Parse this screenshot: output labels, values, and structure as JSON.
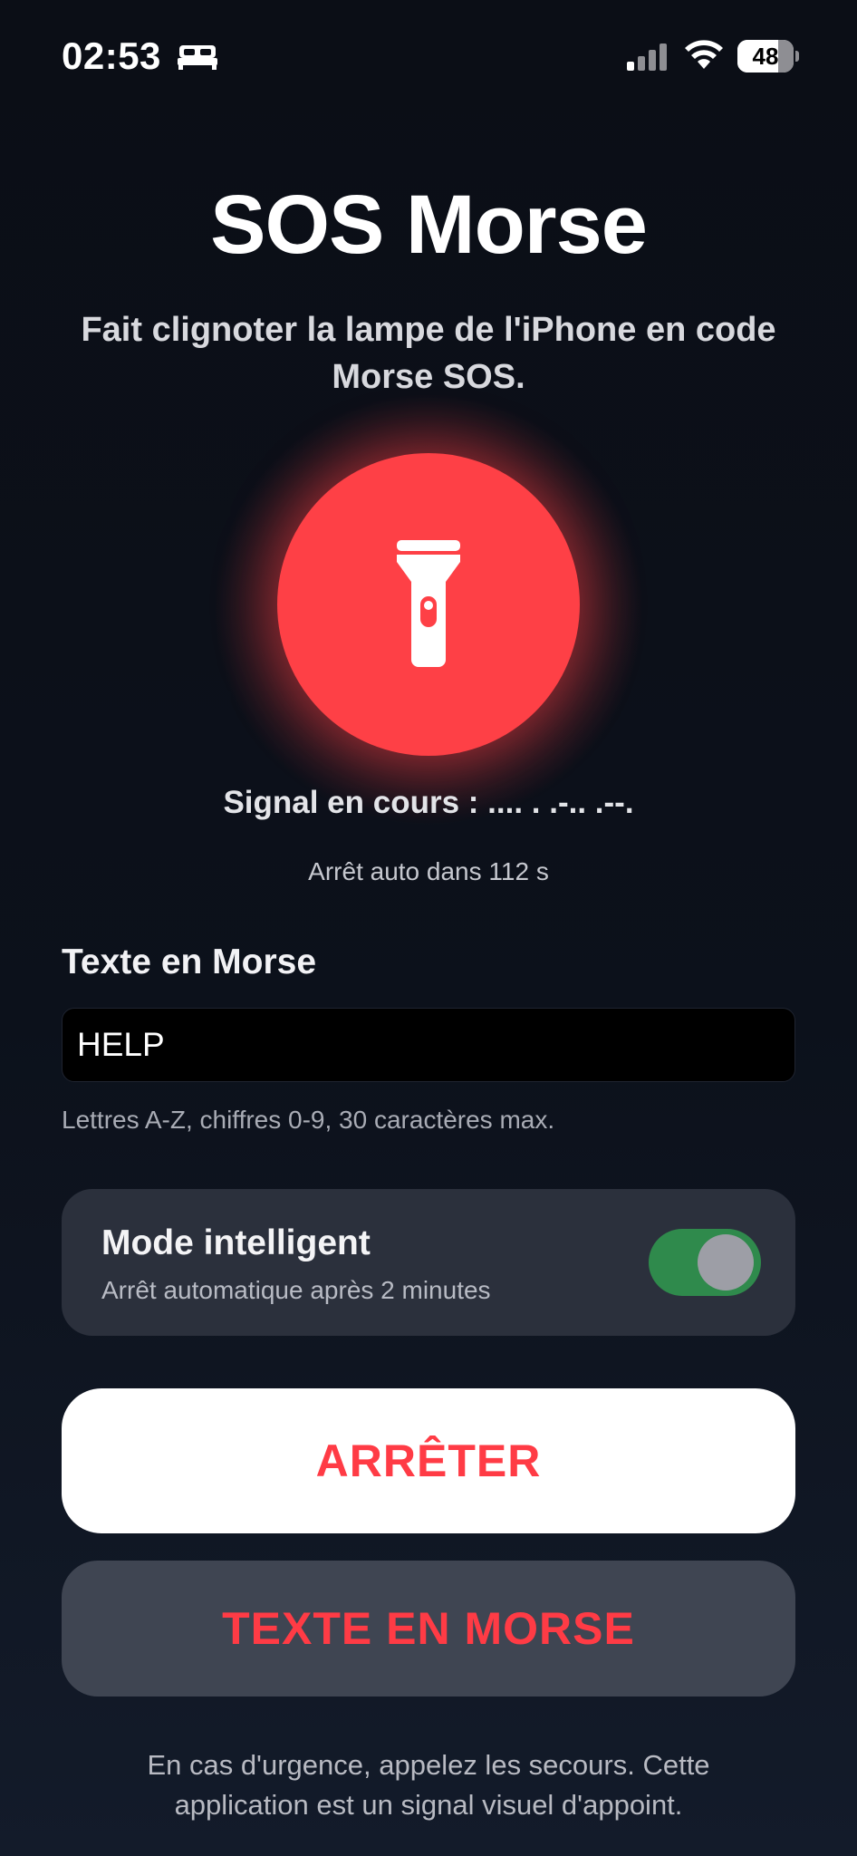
{
  "status_bar": {
    "time": "02:53",
    "battery_percent": "48",
    "battery_level": 0.48,
    "icons": [
      "bed-icon",
      "cellular-signal-icon",
      "wifi-icon",
      "battery-icon"
    ]
  },
  "header": {
    "title": "SOS Morse",
    "subtitle": "Fait clignoter la lampe de l'iPhone en code Morse SOS."
  },
  "flash": {
    "icon": "flashlight-icon",
    "color": "#fe4046"
  },
  "signal": {
    "status": "Signal en cours : .... . .-.. .--.",
    "auto_stop": "Arrêt auto dans 112 s"
  },
  "text_section": {
    "label": "Texte en Morse",
    "value": "HELP",
    "hint": "Lettres A-Z, chiffres 0-9, 30 caractères max."
  },
  "smart_mode": {
    "title": "Mode intelligent",
    "description": "Arrêt automatique après 2 minutes",
    "enabled": true,
    "toggle_color": "#2f8a4c"
  },
  "buttons": {
    "stop_label": "ARRÊTER",
    "morse_label": "TEXTE EN MORSE",
    "accent_color": "#ff3b45"
  },
  "footer": {
    "note": "En cas d'urgence, appelez les secours. Cette application est un signal visuel d'appoint."
  }
}
